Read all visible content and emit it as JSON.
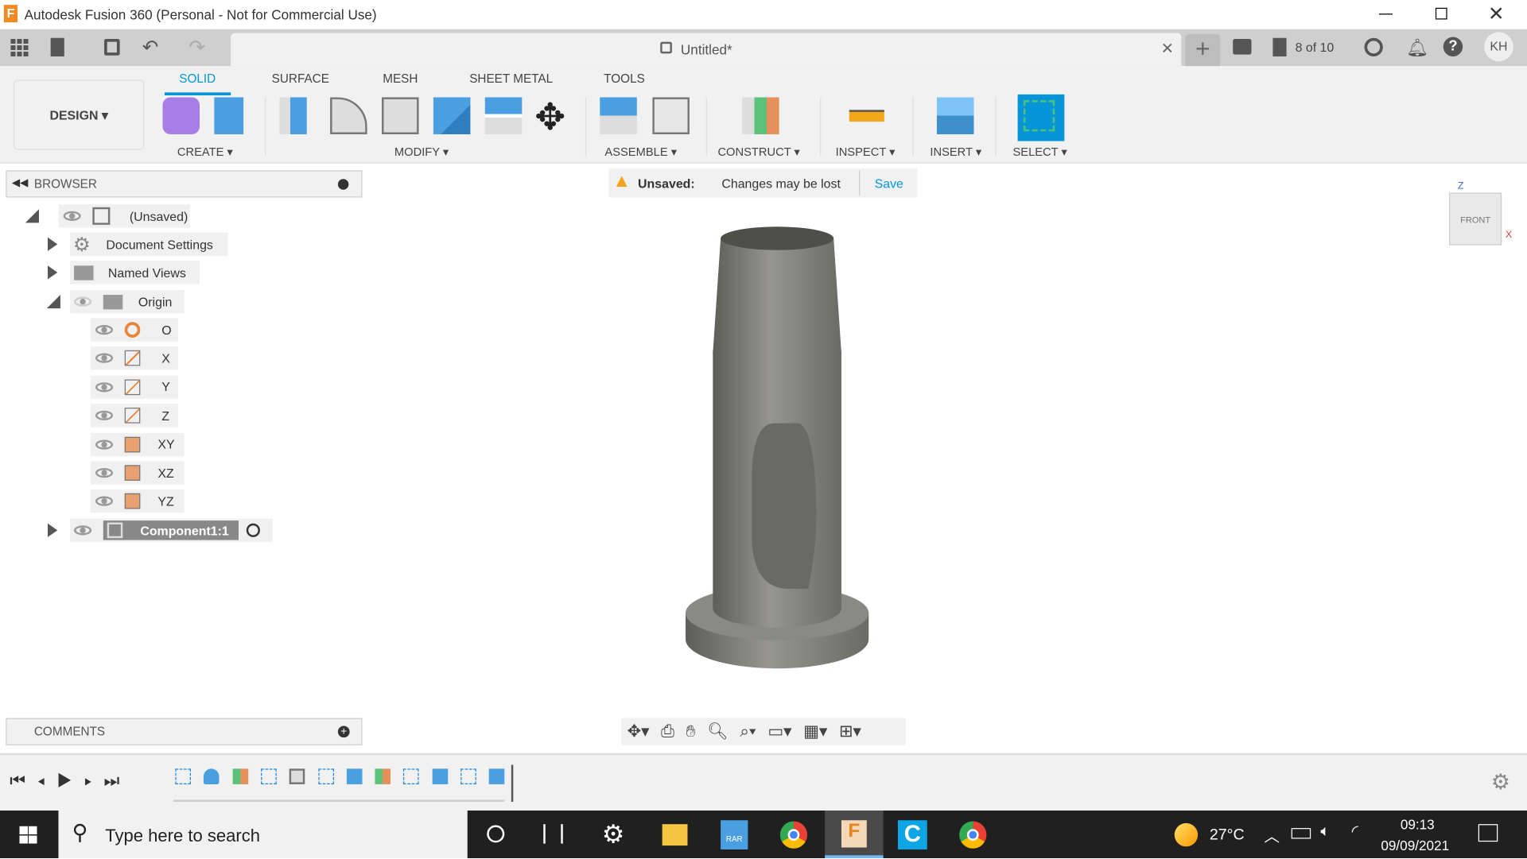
{
  "window": {
    "title": "Autodesk Fusion 360 (Personal - Not for Commercial Use)",
    "app_icon": "fusion-f-icon"
  },
  "document": {
    "title": "Untitled*",
    "lock_icon": "lock-icon",
    "jobs": "8 of 10",
    "user_initials": "KH"
  },
  "workspace": {
    "label": "DESIGN"
  },
  "tabs": [
    {
      "label": "SOLID",
      "active": true
    },
    {
      "label": "SURFACE"
    },
    {
      "label": "MESH"
    },
    {
      "label": "SHEET METAL"
    },
    {
      "label": "TOOLS"
    }
  ],
  "groups": [
    "CREATE",
    "MODIFY",
    "ASSEMBLE",
    "CONSTRUCT",
    "INSPECT",
    "INSERT",
    "SELECT"
  ],
  "accent": "#0696d7",
  "browser": {
    "title": "BROWSER",
    "root": "(Unsaved)",
    "items": [
      "Document Settings",
      "Named Views",
      "Origin"
    ],
    "origin_items": [
      "O",
      "X",
      "Y",
      "Z",
      "XY",
      "XZ",
      "YZ"
    ],
    "component": "Component1:1"
  },
  "banner": {
    "title": "Unsaved:",
    "message": "Changes may be lost",
    "save": "Save"
  },
  "viewcube": {
    "face": "FRONT",
    "z": "Z",
    "x": "X"
  },
  "comments": {
    "title": "COMMENTS"
  },
  "taskbar": {
    "search_placeholder": "Type here to search",
    "temperature": "27°C",
    "time": "09:13",
    "date": "09/09/2021"
  }
}
